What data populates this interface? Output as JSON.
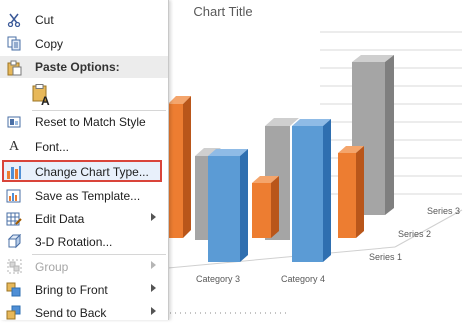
{
  "chart": {
    "title": "Chart Title",
    "categories_visible": [
      "Category 3",
      "Category 4"
    ],
    "series_labels": [
      "Series 1",
      "Series 2",
      "Series 3"
    ],
    "colors": {
      "series1": "#4f8fd6",
      "series2": "#ed7d31",
      "series3": "#a5a5a5"
    }
  },
  "menu": {
    "items": [
      {
        "key": "cut",
        "label": "Cut",
        "icon": "scissors-icon"
      },
      {
        "key": "copy",
        "label": "Copy",
        "icon": "copy-icon"
      },
      {
        "key": "paste_options",
        "label": "Paste Options:",
        "icon": "paste-icon"
      },
      {
        "key": "paste_keep",
        "label": "",
        "icon": "paste-keep-text-icon"
      },
      {
        "key": "reset_style",
        "label": "Reset to Match Style",
        "icon": "reset-style-icon"
      },
      {
        "key": "font",
        "label": "Font...",
        "icon": "font-a-icon"
      },
      {
        "key": "change_chart_type",
        "label": "Change Chart Type...",
        "icon": "bar-chart-icon"
      },
      {
        "key": "save_template",
        "label": "Save as Template...",
        "icon": "save-template-icon"
      },
      {
        "key": "edit_data",
        "label": "Edit Data",
        "icon": "table-edit-icon"
      },
      {
        "key": "rotation_3d",
        "label": "3-D Rotation...",
        "icon": "cube-icon"
      },
      {
        "key": "group",
        "label": "Group",
        "icon": "group-icon"
      },
      {
        "key": "bring_front",
        "label": "Bring to Front",
        "icon": "bring-front-icon"
      },
      {
        "key": "send_back",
        "label": "Send to Back",
        "icon": "send-back-icon"
      }
    ]
  }
}
